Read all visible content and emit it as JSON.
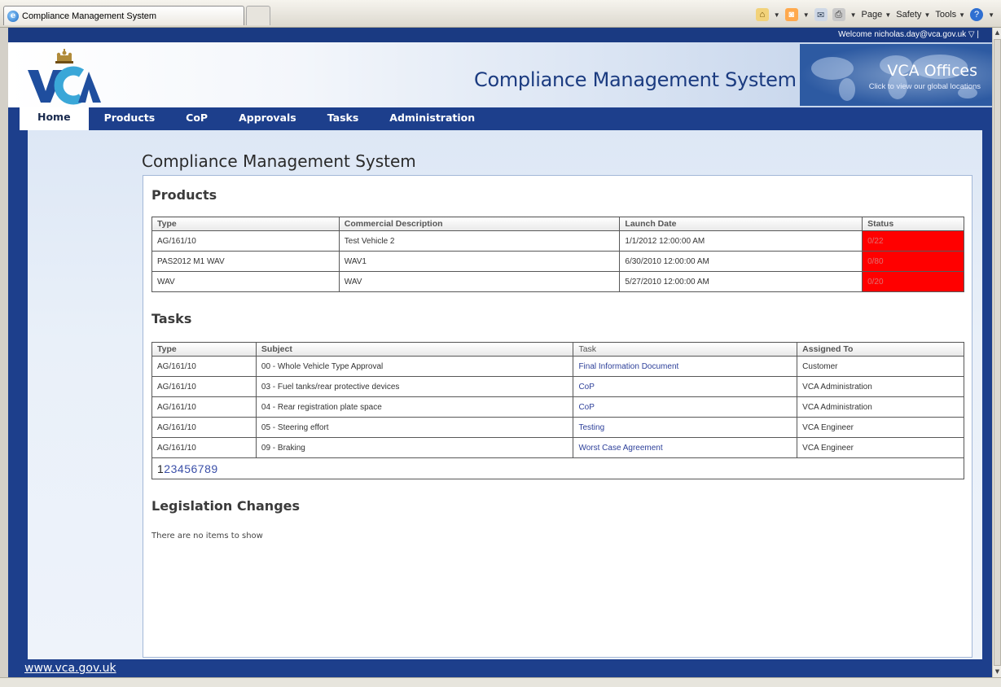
{
  "browser": {
    "tab_title": "Compliance Management System",
    "toolbar": {
      "page": "Page",
      "safety": "Safety",
      "tools": "Tools"
    }
  },
  "header": {
    "welcome": "Welcome nicholas.day@vca.gov.uk ▽ |",
    "site_title": "Compliance Management System",
    "offices_title": "VCA Offices",
    "offices_subtitle": "Click to view our global locations",
    "logo_text": "VCA"
  },
  "nav": {
    "items": [
      "Home",
      "Products",
      "CoP",
      "Approvals",
      "Tasks",
      "Administration"
    ],
    "active": "Home"
  },
  "main": {
    "heading": "Compliance Management System",
    "products": {
      "title": "Products",
      "columns": [
        "Type",
        "Commercial Description",
        "Launch Date",
        "Status"
      ],
      "rows": [
        [
          "AG/161/10",
          "Test Vehicle 2",
          "1/1/2012 12:00:00 AM",
          "0/22"
        ],
        [
          "PAS2012 M1 WAV",
          "WAV1",
          "6/30/2010 12:00:00 AM",
          "0/80"
        ],
        [
          "WAV",
          "WAV",
          "5/27/2010 12:00:00 AM",
          "0/20"
        ]
      ],
      "status_color": "#ff0000"
    },
    "tasks": {
      "title": "Tasks",
      "columns": [
        "Type",
        "Subject",
        "Task",
        "Assigned To"
      ],
      "rows": [
        [
          "AG/161/10",
          "00 - Whole Vehicle Type Approval",
          "Final Information Document",
          "Customer"
        ],
        [
          "AG/161/10",
          "03 - Fuel tanks/rear protective devices",
          "CoP",
          "VCA Administration"
        ],
        [
          "AG/161/10",
          "04 - Rear registration plate space",
          "CoP",
          "VCA Administration"
        ],
        [
          "AG/161/10",
          "05 - Steering effort",
          "Testing",
          "VCA Engineer"
        ],
        [
          "AG/161/10",
          "09 - Braking",
          "Worst Case Agreement",
          "VCA Engineer"
        ]
      ],
      "pager": {
        "current": "1",
        "pages": [
          "2",
          "3",
          "4",
          "5",
          "6",
          "7",
          "8",
          "9"
        ]
      }
    },
    "legislation": {
      "title": "Legislation Changes",
      "empty_text": "There are no items to show"
    }
  },
  "footer": {
    "link": "www.vca.gov.uk"
  },
  "colors": {
    "brand": "#1d3f8c",
    "link": "#2c3f99"
  }
}
